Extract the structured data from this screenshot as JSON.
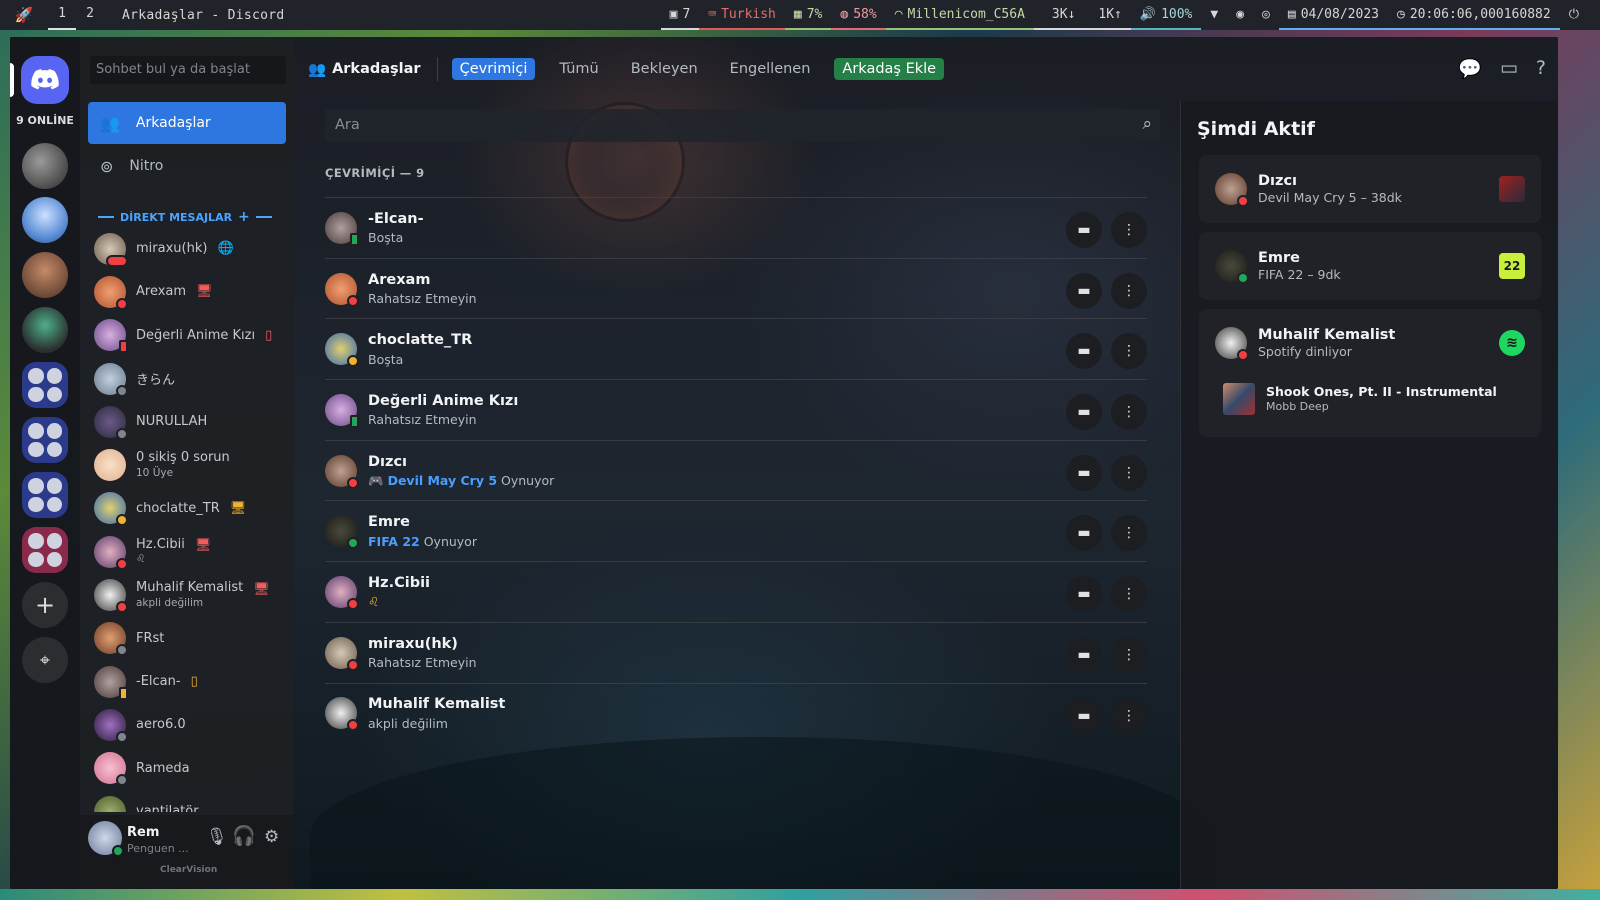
{
  "topbar": {
    "workspaces": [
      "1",
      "2"
    ],
    "window_title": "Arkadaşlar - Discord",
    "windows_count": "7",
    "keyboard": "Turkish",
    "cpu": "7%",
    "memory": "58%",
    "wifi": "Millenicom_C56A",
    "down": "3K↓",
    "up": "1K↑",
    "volume": "100%",
    "date": "04/08/2023",
    "time": "20:06:06,000160882"
  },
  "rail": {
    "online_label": "9 ONLİNE"
  },
  "dm": {
    "search_placeholder": "Sohbet bul ya da başlat",
    "nav_friends": "Arkadaşlar",
    "nav_nitro": "Nitro",
    "section_label": "DİREKT MESAJLAR",
    "items": [
      {
        "name": "miraxu(hk)",
        "sub": ""
      },
      {
        "name": "Arexam",
        "sub": ""
      },
      {
        "name": "Değerli Anime Kızı",
        "sub": ""
      },
      {
        "name": "きらん",
        "sub": ""
      },
      {
        "name": "NURULLAH",
        "sub": ""
      },
      {
        "name": "0 sikiş 0 sorun",
        "sub": "10 Üye"
      },
      {
        "name": "choclatte_TR",
        "sub": ""
      },
      {
        "name": "Hz.Cibii",
        "sub": "♌"
      },
      {
        "name": "Muhalif Kemalist",
        "sub": "akpli değilim"
      },
      {
        "name": "FRst",
        "sub": ""
      },
      {
        "name": "-Elcan-",
        "sub": ""
      },
      {
        "name": "aero6.0",
        "sub": ""
      },
      {
        "name": "Rameda",
        "sub": ""
      },
      {
        "name": "vantilatör",
        "sub": ""
      }
    ]
  },
  "user": {
    "name": "Rem",
    "status": "Penguen ...",
    "theme_label": "ClearVision"
  },
  "header": {
    "title": "Arkadaşlar",
    "tabs": [
      "Çevrimiçi",
      "Tümü",
      "Bekleyen",
      "Engellenen"
    ],
    "add_friend": "Arkadaş Ekle"
  },
  "friends": {
    "search_placeholder": "Ara",
    "online_header": "ÇEVRİMİÇİ — 9",
    "rows": [
      {
        "name": "-Elcan-",
        "status": "Boşta",
        "game": "",
        "suffix": ""
      },
      {
        "name": "Arexam",
        "status": "Rahatsız Etmeyin",
        "game": "",
        "suffix": ""
      },
      {
        "name": "choclatte_TR",
        "status": "Boşta",
        "game": "",
        "suffix": ""
      },
      {
        "name": "Değerli Anime Kızı",
        "status": "Rahatsız Etmeyin",
        "game": "",
        "suffix": ""
      },
      {
        "name": "Dızcı",
        "status": "",
        "game": "Devil May Cry 5",
        "suffix": "Oynuyor"
      },
      {
        "name": "Emre",
        "status": "",
        "game": "FIFA 22",
        "suffix": "Oynuyor"
      },
      {
        "name": "Hz.Cibii",
        "status": "♌",
        "game": "",
        "suffix": ""
      },
      {
        "name": "miraxu(hk)",
        "status": "Rahatsız Etmeyin",
        "game": "",
        "suffix": ""
      },
      {
        "name": "Muhalif Kemalist",
        "status": "akpli değilim",
        "game": "",
        "suffix": ""
      }
    ]
  },
  "active_now": {
    "title": "Şimdi Aktif",
    "cards": [
      {
        "name": "Dızcı",
        "activity": "Devil May Cry 5 – 38dk"
      },
      {
        "name": "Emre",
        "activity": "FIFA 22 – 9dk",
        "badge": "22"
      },
      {
        "name": "Muhalif Kemalist",
        "activity": "Spotify dinliyor",
        "track": "Shook Ones, Pt. II - Instrumental",
        "artist": "Mobb Deep"
      }
    ]
  },
  "colors": {
    "accent_blue": "#2f77e0",
    "add_green": "#248046",
    "blurple": "#5865f2",
    "dnd": "#f23f43",
    "idle": "#f0b232",
    "online": "#23a55a"
  }
}
